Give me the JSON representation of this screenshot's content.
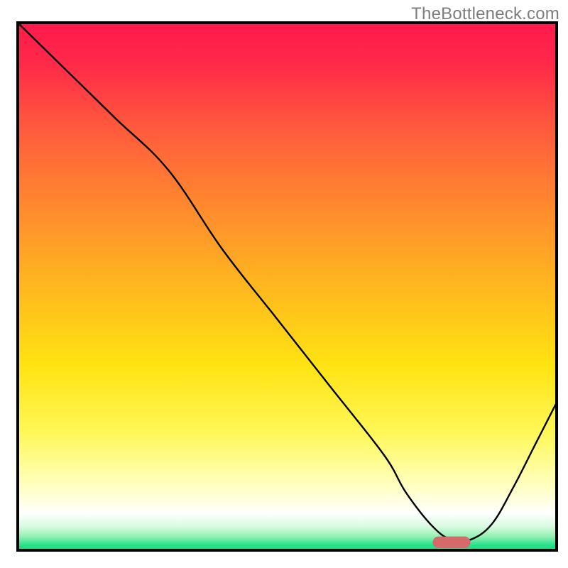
{
  "watermark": "TheBottleneck.com",
  "chart_data": {
    "type": "line",
    "title": "",
    "xlabel": "",
    "ylabel": "",
    "xlim": [
      0,
      100
    ],
    "ylim": [
      0,
      100
    ],
    "grid": false,
    "legend": false,
    "background_gradient_stops": [
      {
        "offset": 0.0,
        "color": "#ff1a4b"
      },
      {
        "offset": 0.08,
        "color": "#ff2a49"
      },
      {
        "offset": 0.2,
        "color": "#ff5a3d"
      },
      {
        "offset": 0.35,
        "color": "#ff8a2e"
      },
      {
        "offset": 0.5,
        "color": "#ffb71f"
      },
      {
        "offset": 0.65,
        "color": "#ffe312"
      },
      {
        "offset": 0.78,
        "color": "#fff85a"
      },
      {
        "offset": 0.88,
        "color": "#ffffc2"
      },
      {
        "offset": 0.93,
        "color": "#ffffff"
      },
      {
        "offset": 0.955,
        "color": "#d9fbe0"
      },
      {
        "offset": 0.975,
        "color": "#8ef0b0"
      },
      {
        "offset": 0.99,
        "color": "#28e18b"
      },
      {
        "offset": 1.0,
        "color": "#1ed885"
      }
    ],
    "series": [
      {
        "name": "bottleneck-curve",
        "color": "#000000",
        "stroke_width": 2.4,
        "x": [
          0.0,
          8.0,
          18.0,
          28.0,
          38.0,
          48.0,
          58.0,
          68.0,
          72.0,
          77.0,
          80.5,
          84.0,
          88.0,
          92.0,
          96.0,
          100.0
        ],
        "y": [
          100.0,
          92.0,
          82.0,
          72.0,
          57.0,
          44.0,
          31.0,
          18.0,
          11.0,
          4.5,
          2.0,
          2.0,
          5.0,
          12.0,
          20.0,
          28.0
        ]
      }
    ],
    "marker": {
      "name": "optimal-range-marker",
      "x_center": 80.5,
      "y": 1.5,
      "width_x": 7.0,
      "height_y": 2.2,
      "fill": "#d46a6a",
      "rx_ratio": 0.5
    },
    "frame_color": "#000000",
    "frame_width": 4
  }
}
